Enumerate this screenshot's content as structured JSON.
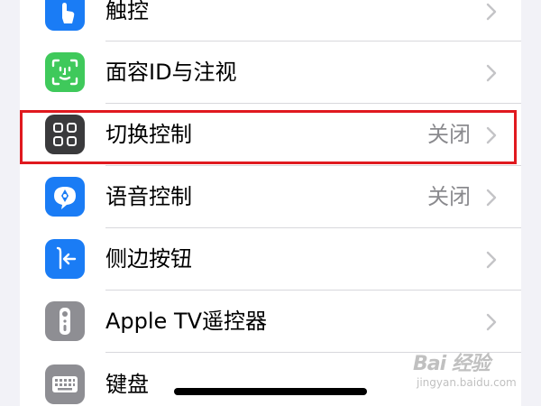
{
  "rows": [
    {
      "label": "触控",
      "value": "",
      "icon": "hand-tap-icon",
      "color": "#1a7cf5"
    },
    {
      "label": "面容ID与注视",
      "value": "",
      "icon": "face-id-icon",
      "color": "#3fc95b"
    },
    {
      "label": "切换控制",
      "value": "关闭",
      "icon": "switch-control-icon",
      "color": "#3a3a3c"
    },
    {
      "label": "语音控制",
      "value": "关闭",
      "icon": "voice-control-icon",
      "color": "#1a7cf5"
    },
    {
      "label": "侧边按钮",
      "value": "",
      "icon": "side-button-icon",
      "color": "#1a7cf5"
    },
    {
      "label": "Apple TV遥控器",
      "value": "",
      "icon": "tv-remote-icon",
      "color": "#8e8e93"
    },
    {
      "label": "键盘",
      "value": "",
      "icon": "keyboard-icon",
      "color": "#8e8e93"
    }
  ],
  "highlight_color": "#e0191f",
  "watermark": {
    "logo": "Bai 经验",
    "sub": "jingyan.baidu.com"
  }
}
